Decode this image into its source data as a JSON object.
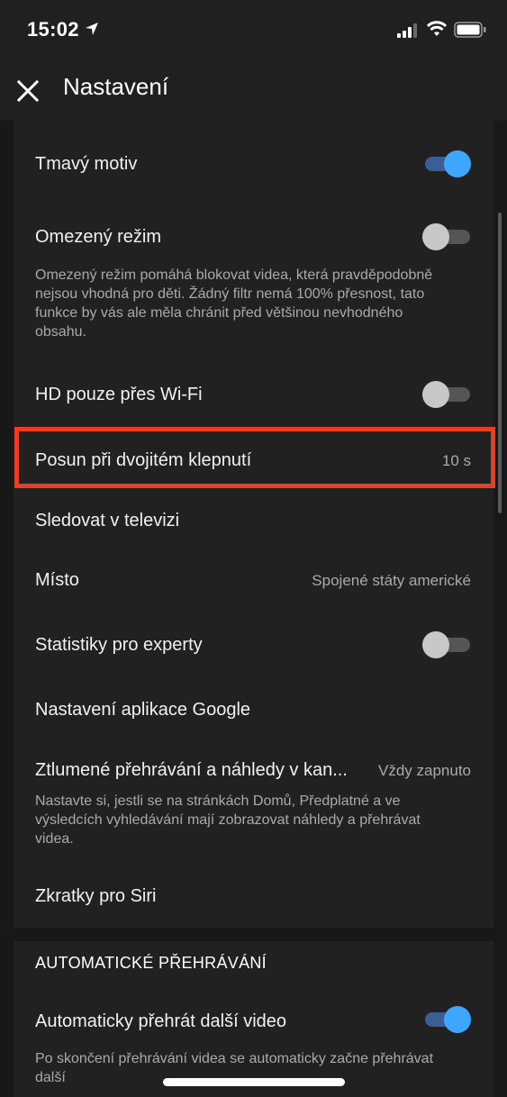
{
  "status_bar": {
    "time": "15:02",
    "icons": [
      "location-arrow-icon",
      "cellular-signal-icon",
      "wifi-icon",
      "battery-icon"
    ]
  },
  "app_bar": {
    "title": "Nastavení",
    "close_icon": "close-icon"
  },
  "settings": {
    "dark_theme": {
      "label": "Tmavý motiv",
      "enabled": true
    },
    "restricted_mode": {
      "label": "Omezený režim",
      "enabled": false,
      "description": "Omezený režim pomáhá blokovat videa, která pravděpodobně nejsou vhodná pro děti. Žádný filtr nemá 100% přesnost, tato funkce by vás ale měla chránit před většinou nevhodného obsahu."
    },
    "hd_wifi_only": {
      "label": "HD pouze přes Wi-Fi",
      "enabled": false
    },
    "double_tap_seek": {
      "label": "Posun při dvojitém klepnutí",
      "value": "10 s"
    },
    "watch_on_tv": {
      "label": "Sledovat v televizi"
    },
    "location": {
      "label": "Místo",
      "value": "Spojené státy americké"
    },
    "stats_for_nerds": {
      "label": "Statistiky pro experty",
      "enabled": false
    },
    "google_app_settings": {
      "label": "Nastavení aplikace Google"
    },
    "muted_playback": {
      "label": "Ztlumené přehrávání a náhledy v kan...",
      "value": "Vždy zapnuto",
      "description": "Nastavte si, jestli se na stránkách Domů, Předplatné a ve výsledcích vyhledávání mají zobrazovat náhledy a přehrávat videa."
    },
    "siri_shortcuts": {
      "label": "Zkratky pro Siri"
    }
  },
  "autoplay_section": {
    "header": "AUTOMATICKÉ PŘEHRÁVÁNÍ",
    "autoplay_next": {
      "label": "Automaticky přehrát další video",
      "enabled": true,
      "description": "Po skončení přehrávání videa se automaticky začne přehrávat další"
    }
  },
  "colors": {
    "background": "#181818",
    "card": "#212121",
    "accent": "#3ea6ff",
    "highlight_border": "#e83e23"
  }
}
